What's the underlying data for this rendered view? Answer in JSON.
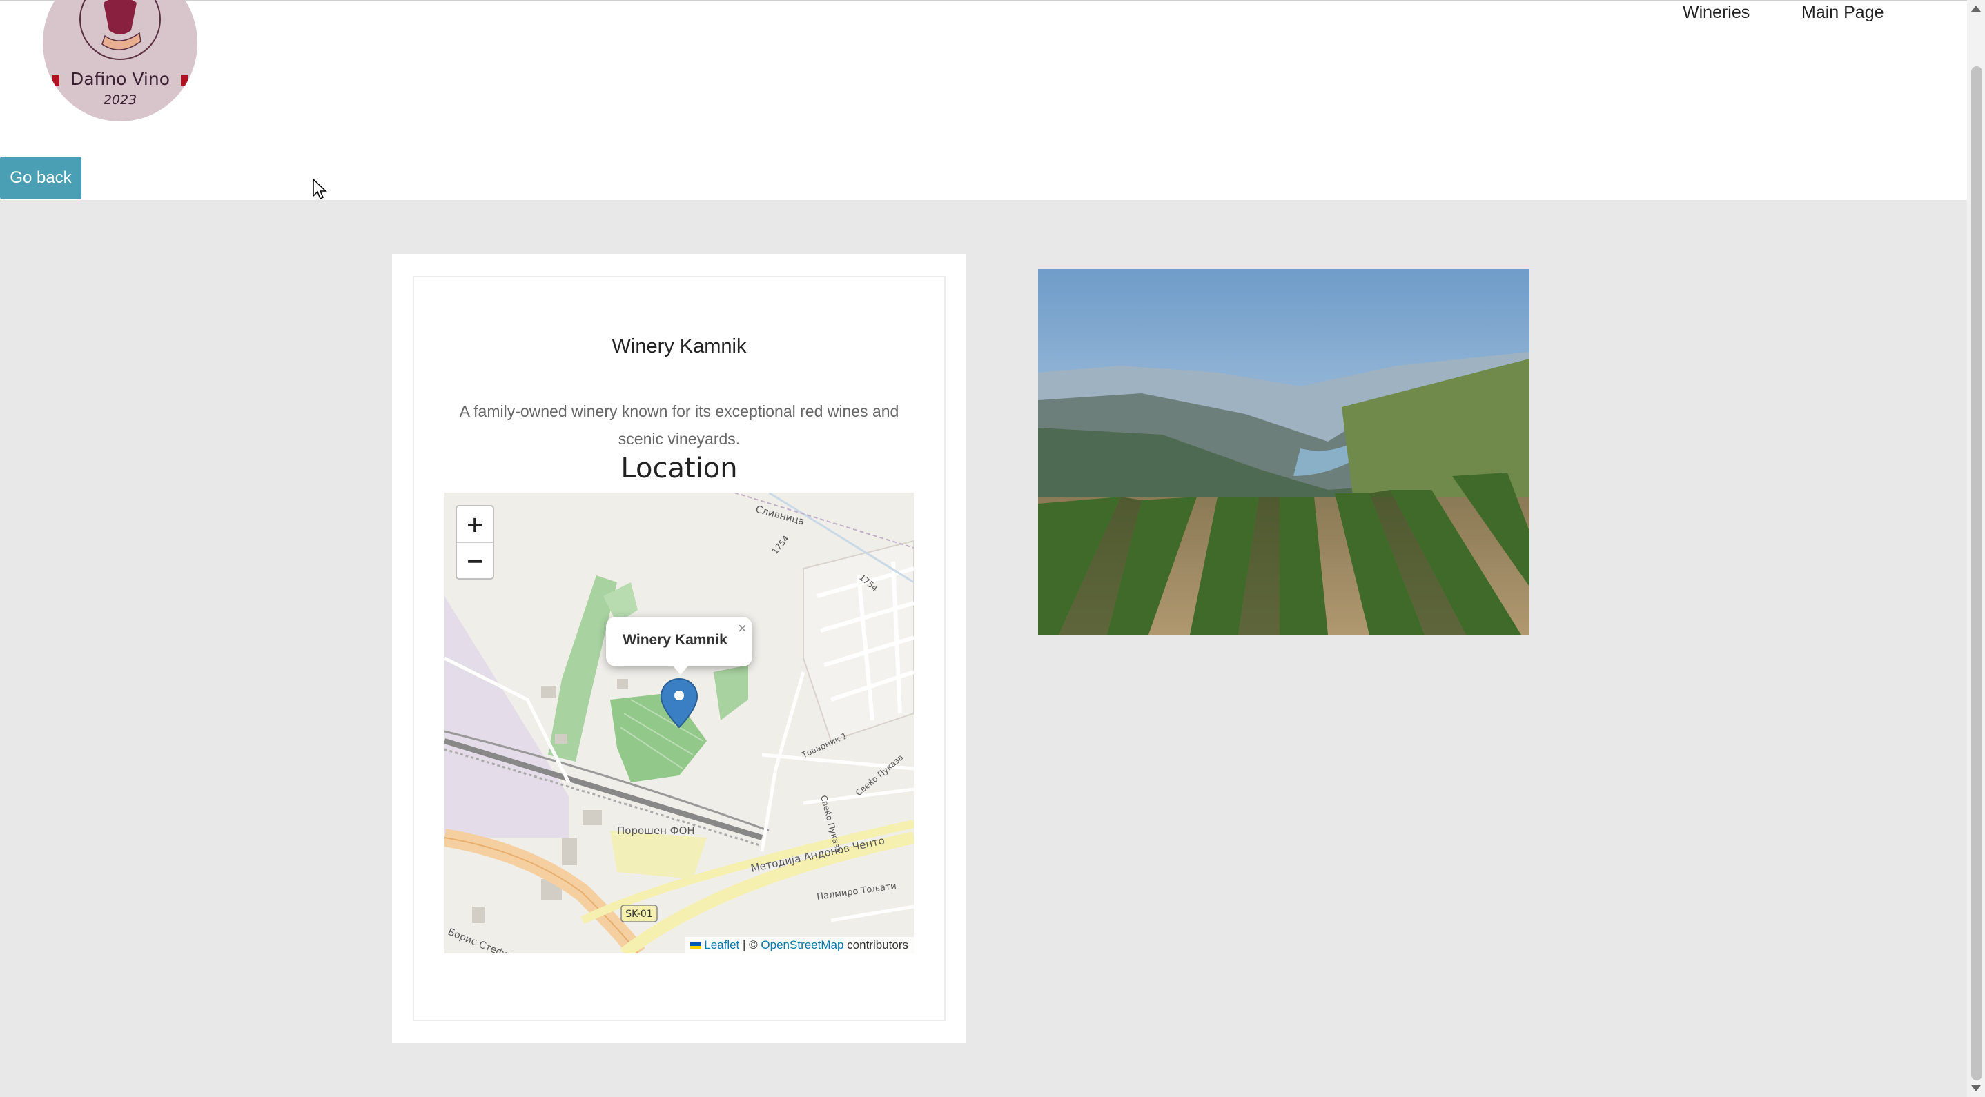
{
  "header": {
    "logo": {
      "name": "Dafino Vino",
      "year": "2023"
    },
    "nav": [
      {
        "label": "Wineries"
      },
      {
        "label": "Main Page"
      }
    ],
    "go_back": "Go back"
  },
  "winery": {
    "name": "Winery Kamnik",
    "description": "A family-owned winery known for its exceptional red wines and scenic vineyards.",
    "location_heading": "Location"
  },
  "map": {
    "zoom_in": "+",
    "zoom_out": "−",
    "popup_label": "Winery Kamnik",
    "popup_close": "×",
    "labels": {
      "road_main": "Методија Андонов Ченто",
      "road_shield": "SK-01",
      "area": "Порошен ФОН",
      "street_1": "Сливница",
      "street_2": "Товарник 1",
      "street_3": "Свеќо Пуказа",
      "street_4": "Палмиро Тољати",
      "street_5": "Борис Стефановски",
      "num_1": "1754",
      "num_2": "1754"
    },
    "attribution": {
      "leaflet": "Leaflet",
      "separator": "| ©",
      "osm": "OpenStreetMap",
      "contributors": "contributors"
    }
  },
  "icons": {
    "marker": "map-marker-icon",
    "cursor": "mouse-cursor-icon",
    "logo_glass": "wine-glass-icon"
  },
  "colors": {
    "accent": "#4a9fb5",
    "background": "#e8e8e8",
    "marker": "#3a7fc4"
  }
}
